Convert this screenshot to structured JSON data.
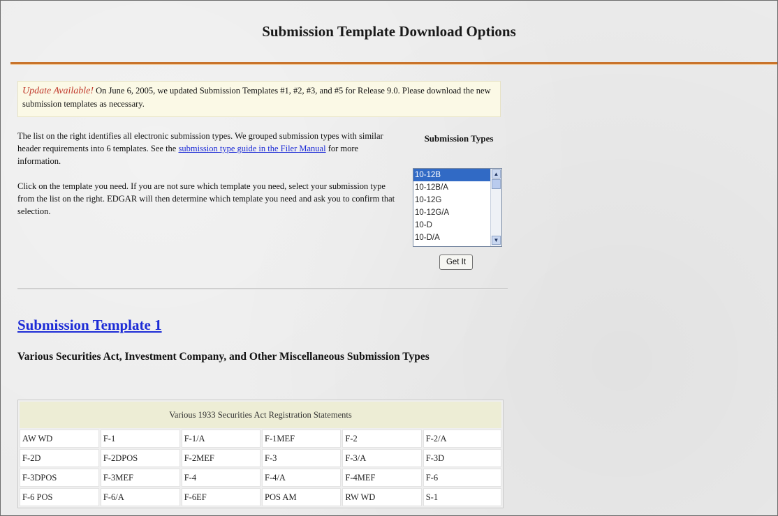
{
  "page": {
    "title": "Submission Template Download Options"
  },
  "update_notice": {
    "label": "Update Available!",
    "text": " On June 6, 2005, we updated Submission Templates #1, #2, #3, and #5 for Release 9.0. Please download the new submission templates as necessary."
  },
  "intro": {
    "p1_before_link": "The list on the right identifies all electronic submission types. We grouped submission types with similar header requirements into 6 templates. See the ",
    "p1_link": "submission type guide in the Filer Manual",
    "p1_after_link": " for more information.",
    "p2": "Click on the template you need. If you are not sure which template you need, select your submission type from the list on the right. EDGAR will then determine which template you need and ask you to confirm that selection."
  },
  "submission_types": {
    "heading": "Submission Types",
    "options": [
      "10-12B",
      "10-12B/A",
      "10-12G",
      "10-12G/A",
      "10-D",
      "10-D/A"
    ],
    "selected": "10-12B",
    "button_label": "Get It"
  },
  "template1": {
    "link": "Submission Template 1",
    "subtitle": "Various Securities Act, Investment Company, and Other Miscellaneous Submission Types",
    "table_header": "Various 1933 Securities Act Registration Statements",
    "rows": [
      [
        "AW WD",
        "F-1",
        "F-1/A",
        "F-1MEF",
        "F-2",
        "F-2/A"
      ],
      [
        "F-2D",
        "F-2DPOS",
        "F-2MEF",
        "F-3",
        "F-3/A",
        "F-3D"
      ],
      [
        "F-3DPOS",
        "F-3MEF",
        "F-4",
        "F-4/A",
        "F-4MEF",
        "F-6"
      ],
      [
        "F-6 POS",
        "F-6/A",
        "F-6EF",
        "POS AM",
        "RW WD",
        "S-1"
      ]
    ]
  },
  "colors": {
    "title_rule": "#c8732b",
    "link": "#1c2bd6",
    "update_label": "#c0392b",
    "list_selection": "#316ac5",
    "table_header_bg": "#ededd5"
  }
}
